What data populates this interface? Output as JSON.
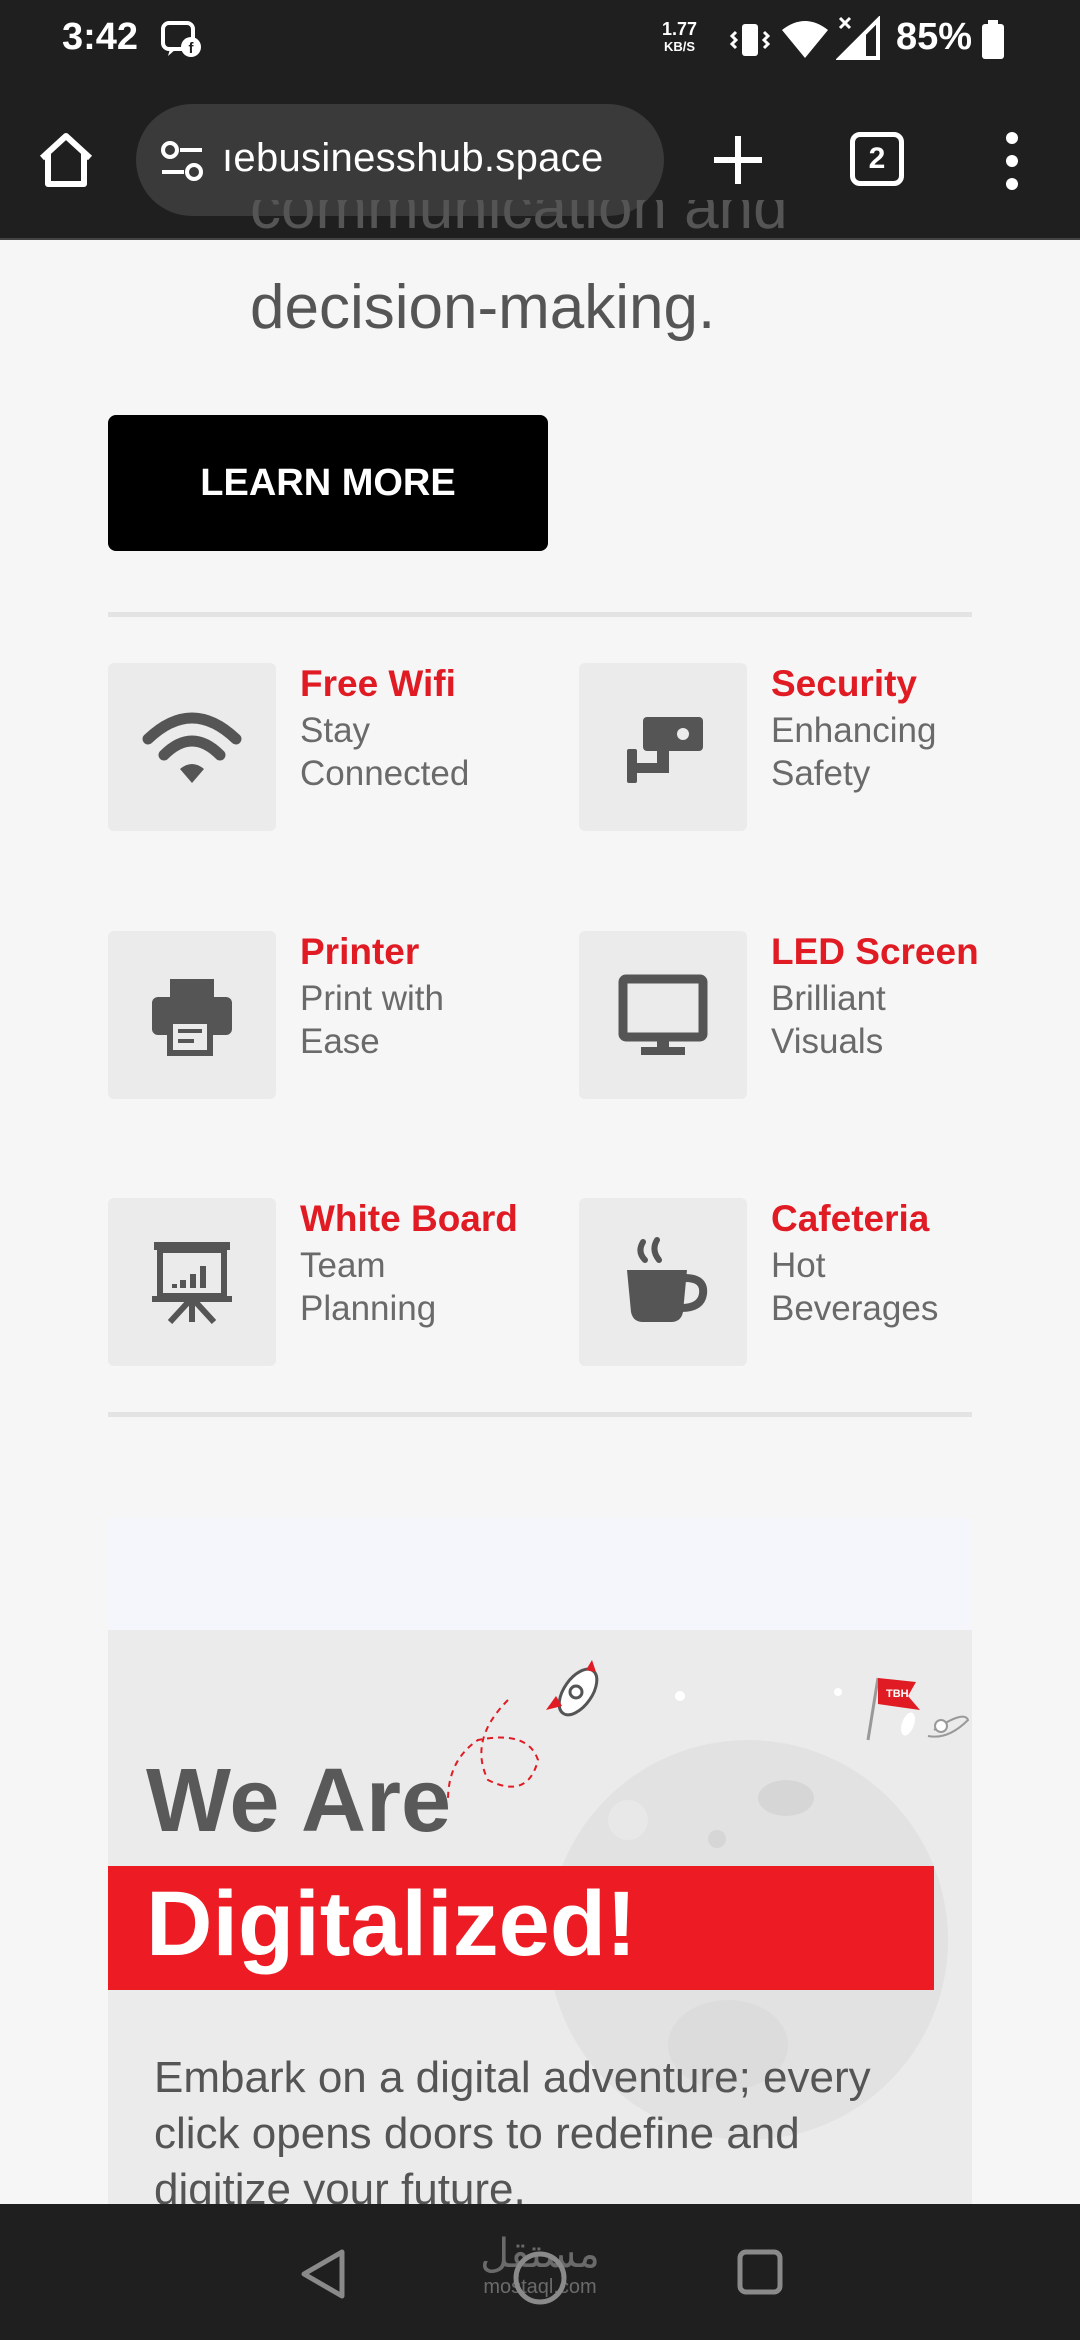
{
  "status_bar": {
    "time": "3:42",
    "net_speed_value": "1.77",
    "net_speed_unit": "KB/S",
    "battery": "85%"
  },
  "browser": {
    "url": "ıebusinesshub.space",
    "tab_count": "2"
  },
  "hero": {
    "partial_line": "communication and",
    "line": "decision-making.",
    "button_label": "LEARN MORE"
  },
  "amenities": [
    {
      "title": "Free Wifi",
      "desc": "Stay Connected",
      "icon": "wifi-icon"
    },
    {
      "title": "Security",
      "desc": "Enhancing Safety",
      "icon": "cctv-icon"
    },
    {
      "title": "Printer",
      "desc": "Print with Ease",
      "icon": "printer-icon"
    },
    {
      "title": "LED Screen",
      "desc": "Brilliant Visuals",
      "icon": "monitor-icon"
    },
    {
      "title": "White Board",
      "desc": "Team Planning",
      "icon": "presentation-board-icon"
    },
    {
      "title": "Cafeteria",
      "desc": "Hot Beverages",
      "icon": "coffee-cup-icon"
    }
  ],
  "banner": {
    "heading_line1": "We Are",
    "heading_line2": "Digitalized!",
    "body": "Embark on a digital adventure; every click opens doors to redefine and digitize your future.",
    "flag_text": "TBH"
  },
  "watermark": {
    "arabic": "مستقل",
    "latin": "mostaql.com"
  },
  "colors": {
    "accent_red": "#e01b24",
    "banner_red": "#ed1c24",
    "button_black": "#000000",
    "system_bar": "#1f1f1f"
  }
}
